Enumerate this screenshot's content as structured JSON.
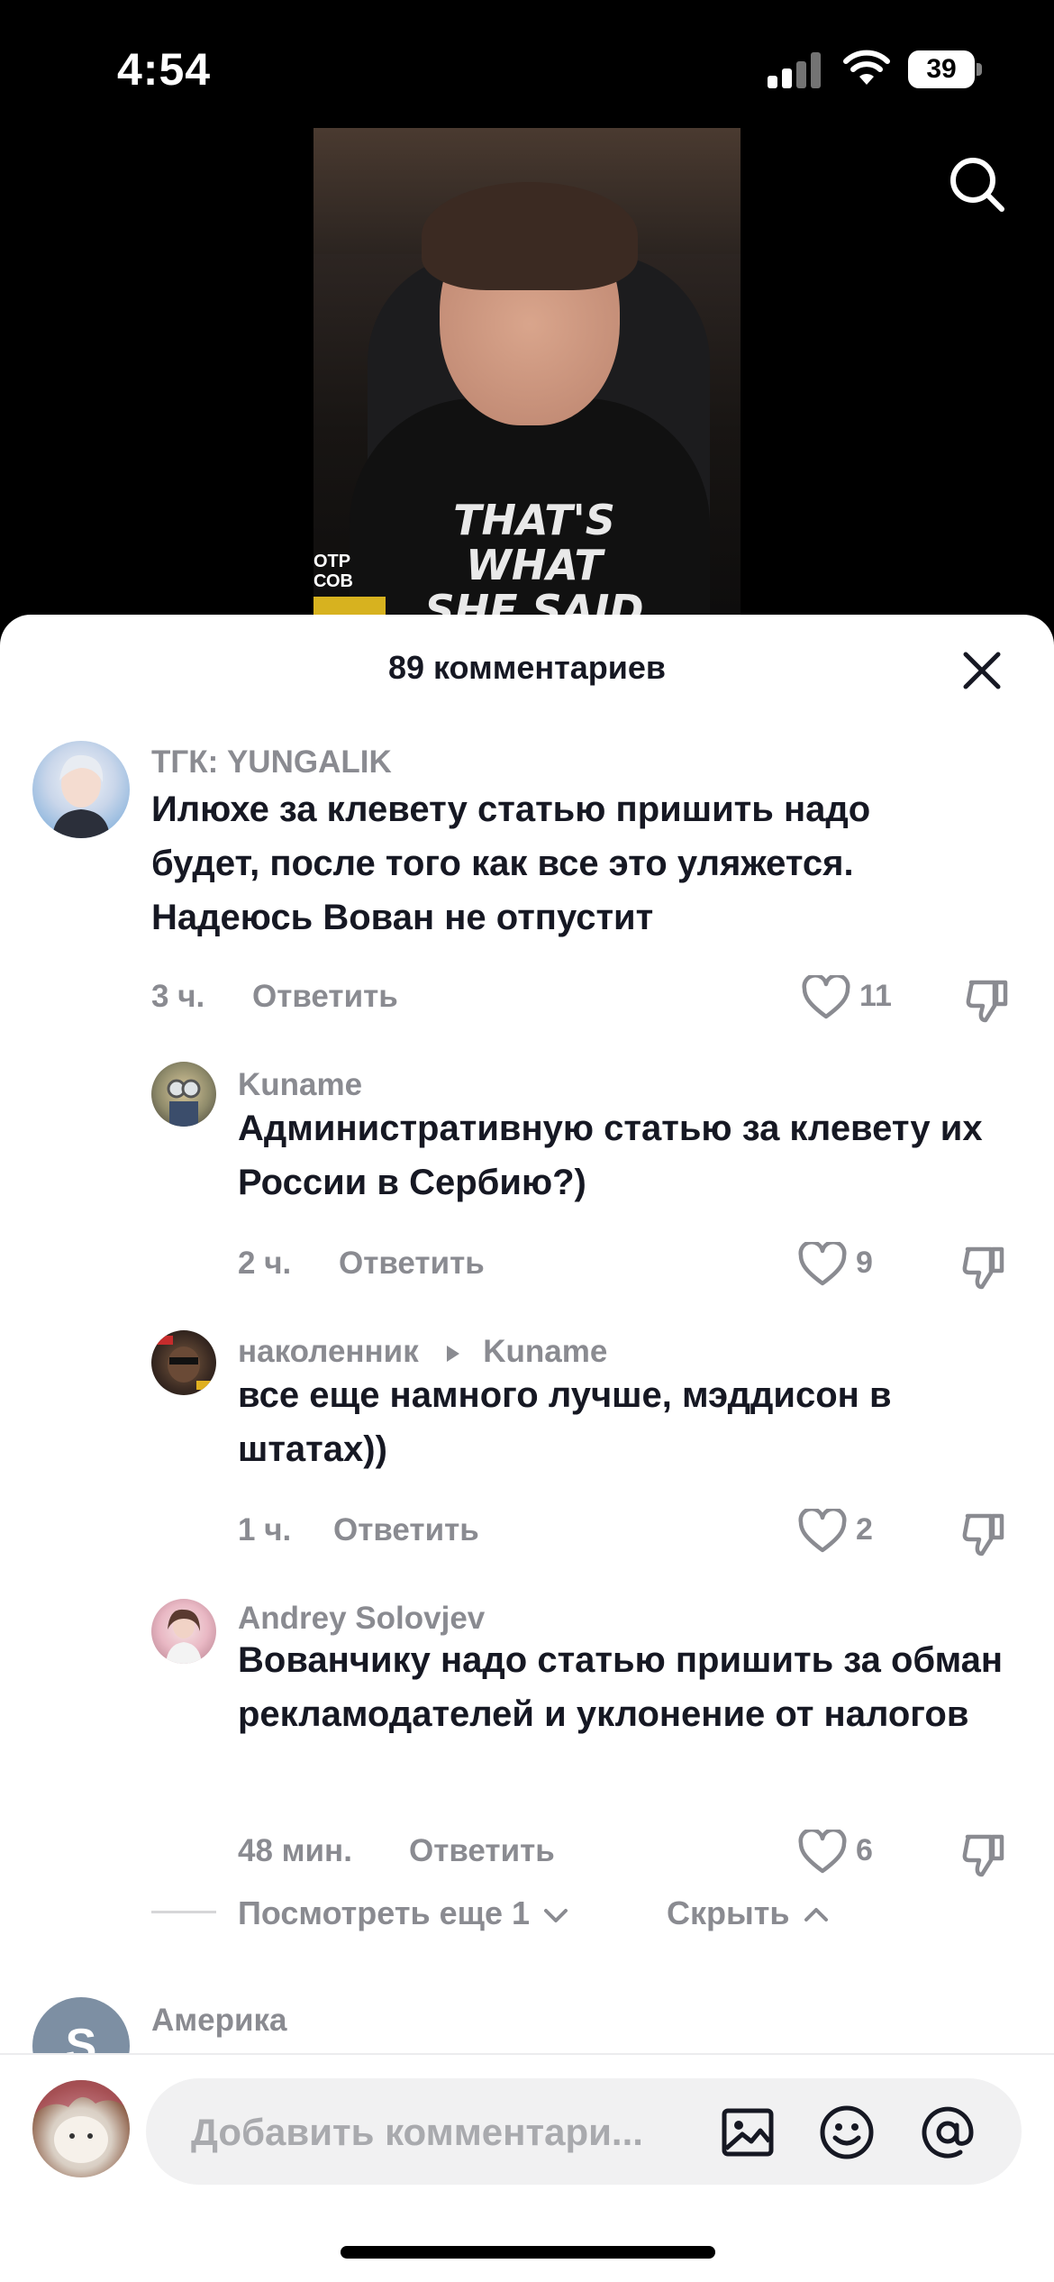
{
  "status_bar": {
    "time": "4:54",
    "battery": "39",
    "icons": [
      "signal-icon",
      "wifi-icon",
      "battery-icon"
    ]
  },
  "video": {
    "shirt_text_line1": "THAT'S WHAT",
    "shirt_text_line2": "SHE SAID",
    "corner_text_line1": "ОТР",
    "corner_text_line2": "СОВ"
  },
  "header": {
    "title": "89 комментариев",
    "icons": [
      "search-icon",
      "close-icon"
    ]
  },
  "comments": [
    {
      "username": "ТГК: YUNGALIK",
      "text": "Илюхе за клевету статью пришить надо будет, после того как все это уляжется. Надеюсь Вован не отпустит",
      "time": "3 ч.",
      "reply_label": "Ответить",
      "likes": "11"
    }
  ],
  "replies": [
    {
      "username": "Kuname",
      "text": "Административную статью за клевету их России в Сербию?)",
      "time": "2 ч.",
      "reply_label": "Ответить",
      "likes": "9"
    },
    {
      "username": "наколенник",
      "reply_to": "Kuname",
      "text": "все еще намного лучше, мэддисон в штатах))",
      "time": "1 ч.",
      "reply_label": "Ответить",
      "likes": "2"
    },
    {
      "username": "Andrey Solovjev",
      "text": "Вованчику надо статью пришить за обман рекламодателей и уклонение от налогов",
      "time": "48 мин.",
      "reply_label": "Ответить",
      "likes": "6"
    }
  ],
  "thread_controls": {
    "view_more": "Посмотреть еще 1",
    "hide": "Скрыть"
  },
  "next_comment": {
    "avatar_letter": "S",
    "username": "Америка"
  },
  "input": {
    "placeholder": "Добавить комментари...",
    "icons": [
      "image-icon",
      "emoji-icon",
      "mention-icon"
    ]
  },
  "colors": {
    "text_primary": "#161823",
    "text_secondary": "#8a8b91",
    "input_bg": "#f1f1f2"
  }
}
